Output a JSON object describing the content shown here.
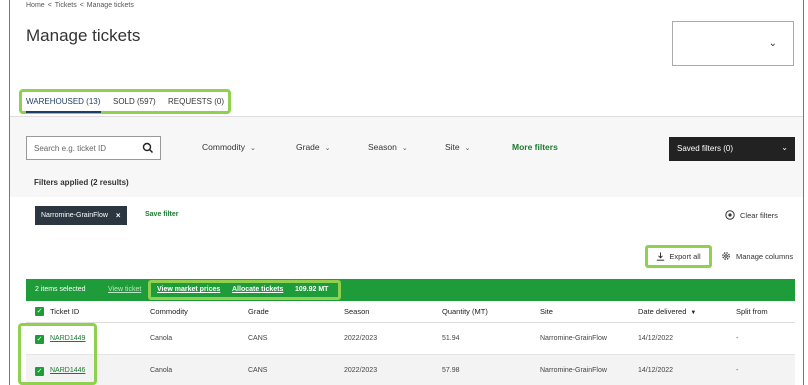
{
  "breadcrumb": {
    "home": "Home",
    "tickets": "Tickets",
    "current": "Manage tickets",
    "separator": "<"
  },
  "page": {
    "title": "Manage tickets"
  },
  "tabs": [
    {
      "label": "WAREHOUSED (13)",
      "active": true
    },
    {
      "label": "SOLD (597)",
      "active": false
    },
    {
      "label": "REQUESTS (0)",
      "active": false
    }
  ],
  "filters": {
    "search_placeholder": "Search e.g. ticket ID",
    "dropdowns": [
      "Commodity",
      "Grade",
      "Season",
      "Site"
    ],
    "more_filters": "More filters",
    "saved_filters": "Saved filters (0)",
    "applied_title": "Filters applied (2 results)",
    "chip": "Narromine-GrainFlow",
    "save_filter": "Save filter",
    "clear_filters": "Clear filters"
  },
  "actions": {
    "export_all": "Export all",
    "manage_columns": "Manage columns"
  },
  "selection": {
    "items_selected": "2 items selected",
    "view_ticket": "View ticket",
    "view_market_prices": "View market prices",
    "allocate_tickets": "Allocate tickets",
    "total_quantity": "109.92 MT"
  },
  "table": {
    "headers": [
      "Ticket ID",
      "Commodity",
      "Grade",
      "Season",
      "Quantity (MT)",
      "Site",
      "Date delivered",
      "Split from"
    ],
    "rows": [
      {
        "ticket_id": "NARD1449",
        "commodity": "Canola",
        "grade": "CANS",
        "season": "2022/2023",
        "quantity": "51.94",
        "site": "Narromine-GrainFlow",
        "date": "14/12/2022",
        "split_from": "-"
      },
      {
        "ticket_id": "NARD1446",
        "commodity": "Canola",
        "grade": "CANS",
        "season": "2022/2023",
        "quantity": "57.98",
        "site": "Narromine-GrainFlow",
        "date": "14/12/2022",
        "split_from": "-"
      }
    ]
  },
  "colors": {
    "accent_green": "#1f9c3a",
    "highlight_green": "#8fd14f",
    "dark": "#222222"
  },
  "icons": {
    "search": "search-icon",
    "chevron": "chevron-down-icon",
    "close": "close-icon",
    "clear": "clear-circle-icon",
    "export": "download-icon",
    "settings": "gear-icon",
    "check": "checkbox-checked-icon"
  }
}
